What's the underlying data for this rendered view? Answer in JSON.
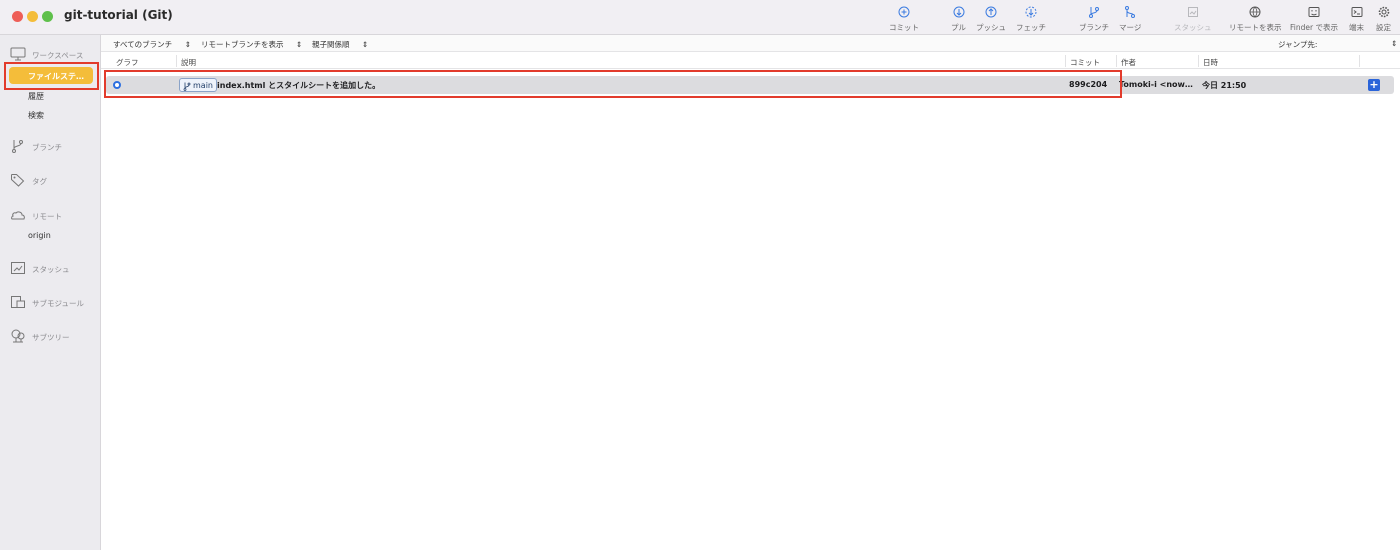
{
  "window": {
    "title": "git-tutorial (Git)"
  },
  "toolbar": {
    "commit": "コミット",
    "pull": "プル",
    "push": "プッシュ",
    "fetch": "フェッチ",
    "branch": "ブランチ",
    "merge": "マージ",
    "stash": "スタッシュ",
    "show_remote": "リモートを表示",
    "show_in_finder": "Finder で表示",
    "terminal": "端末",
    "settings": "設定"
  },
  "sidebar": {
    "workspace": "ワークスペース",
    "file_status": "ファイルステ…",
    "history": "履歴",
    "search": "検索",
    "branches": "ブランチ",
    "tags": "タグ",
    "remotes": "リモート",
    "remote_origin": "origin",
    "stashes": "スタッシュ",
    "submodules": "サブモジュール",
    "subtrees": "サブツリー"
  },
  "filters": {
    "branches": "すべてのブランチ",
    "remote_branches": "リモートブランチを表示",
    "order": "親子関係順",
    "jump_to": "ジャンプ先:"
  },
  "columns": {
    "graph": "グラフ",
    "description": "説明",
    "commit": "コミット",
    "author": "作者",
    "date": "日時"
  },
  "commits": [
    {
      "branch": "main",
      "message": "index.html とスタイルシートを追加した。",
      "hash": "899c204",
      "author": "Tomoki-i <now…",
      "date": "今日 21:50"
    }
  ],
  "colors": {
    "accent": "#f4bd3a",
    "highlight": "#e23b2c",
    "graph": "#2c6fe0"
  }
}
